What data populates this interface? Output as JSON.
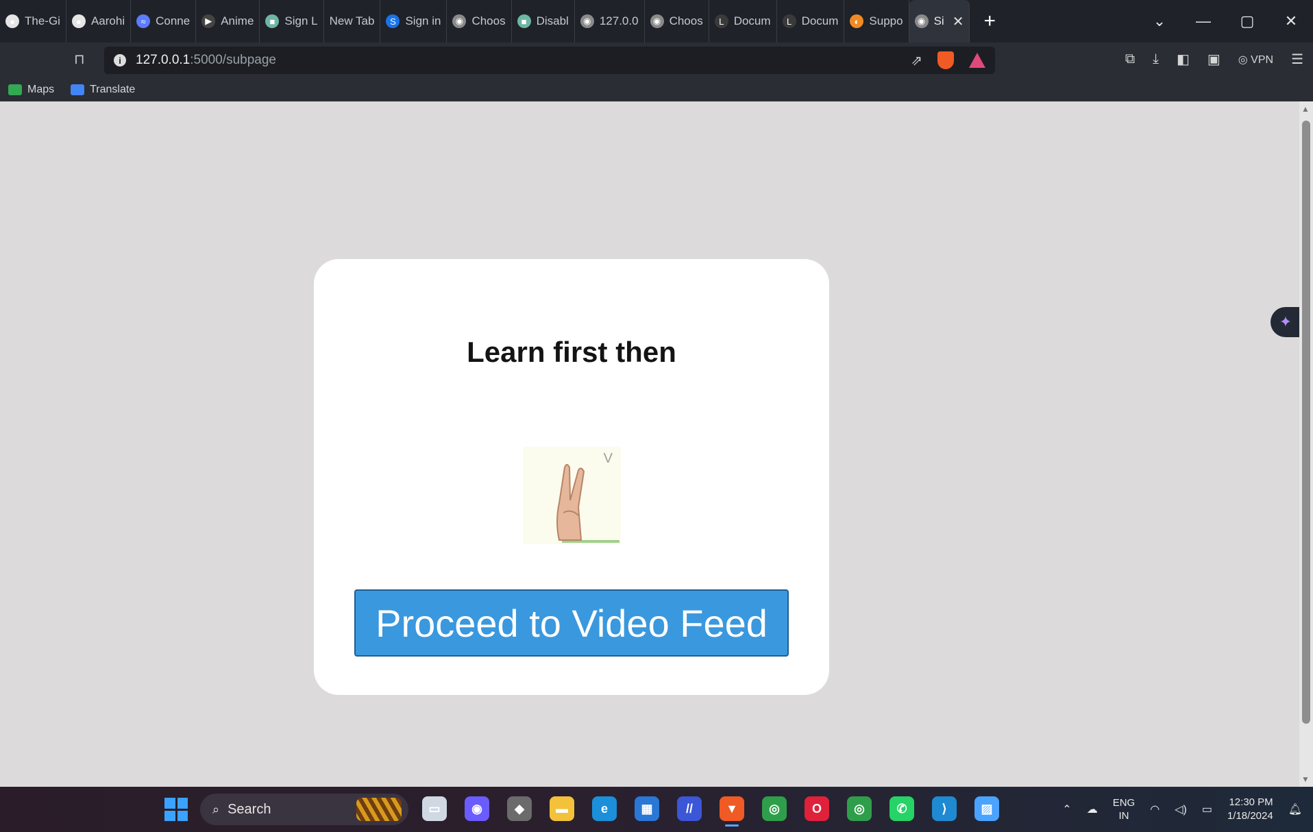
{
  "browser": {
    "tabs": [
      {
        "label": "The-Gi",
        "color": "#e5e5e5",
        "glyph": "●"
      },
      {
        "label": "Aarohi",
        "color": "#e5e5e5",
        "glyph": "●"
      },
      {
        "label": "Conne",
        "color": "#5b7cff",
        "glyph": "≈"
      },
      {
        "label": "Anime",
        "color": "#444444",
        "glyph": "▶"
      },
      {
        "label": "Sign L",
        "color": "#6fb5a4",
        "glyph": "■"
      },
      {
        "label": "New Tab",
        "color": "",
        "glyph": ""
      },
      {
        "label": "Sign in",
        "color": "#1a73e8",
        "glyph": "S"
      },
      {
        "label": "Choos",
        "color": "#8a8a8a",
        "glyph": "◉"
      },
      {
        "label": "Disabl",
        "color": "#6fb5a4",
        "glyph": "■"
      },
      {
        "label": "127.0.0",
        "color": "#8a8a8a",
        "glyph": "◉"
      },
      {
        "label": "Choos",
        "color": "#8a8a8a",
        "glyph": "◉"
      },
      {
        "label": "Docum",
        "color": "#3a3a3a",
        "glyph": "L"
      },
      {
        "label": "Docum",
        "color": "#3a3a3a",
        "glyph": "L"
      },
      {
        "label": "Suppo",
        "color": "#f08a24",
        "glyph": "◐"
      }
    ],
    "active_tab": {
      "label": "Si",
      "close": "✕"
    },
    "new_tab": "+",
    "window_controls": {
      "dropdown": "⌄",
      "minimize": "—",
      "maximize": "▢",
      "close": "✕"
    },
    "address": {
      "host": "127.0.0.1",
      "path": ":5000/subpage"
    },
    "bookmarks": [
      {
        "label": "Maps",
        "color": "#34a853"
      },
      {
        "label": "Translate",
        "color": "#4285f4"
      }
    ],
    "vpn_label": "◎ VPN"
  },
  "page": {
    "title": "Learn first then",
    "sign_letter": "V",
    "proceed_button": "Proceed to Video Feed"
  },
  "taskbar": {
    "search_label": "Search",
    "apps": [
      {
        "name": "task-view",
        "color": "#cfd8e3",
        "glyph": "▭"
      },
      {
        "name": "meet",
        "color": "#6a5cff",
        "glyph": "◉"
      },
      {
        "name": "copilot",
        "color": "#6b6b6b",
        "glyph": "◆"
      },
      {
        "name": "explorer",
        "color": "#f3c13a",
        "glyph": "▬"
      },
      {
        "name": "edge",
        "color": "#1b8fd9",
        "glyph": "e"
      },
      {
        "name": "store",
        "color": "#2a77d6",
        "glyph": "▦"
      },
      {
        "name": "app-blue",
        "color": "#3b56d6",
        "glyph": "//"
      },
      {
        "name": "brave",
        "color": "#f05a24",
        "glyph": "▼"
      },
      {
        "name": "chrome",
        "color": "#2f9e4a",
        "glyph": "◎"
      },
      {
        "name": "opera",
        "color": "#e0213a",
        "glyph": "O"
      },
      {
        "name": "chrome-profile",
        "color": "#2f9e4a",
        "glyph": "◎"
      },
      {
        "name": "whatsapp",
        "color": "#25d366",
        "glyph": "✆"
      },
      {
        "name": "vscode",
        "color": "#1f8ad2",
        "glyph": "⟩"
      },
      {
        "name": "photos",
        "color": "#4aa3ff",
        "glyph": "▨"
      }
    ],
    "lang": {
      "line1": "ENG",
      "line2": "IN"
    },
    "time": "12:30 PM",
    "date": "1/18/2024"
  }
}
